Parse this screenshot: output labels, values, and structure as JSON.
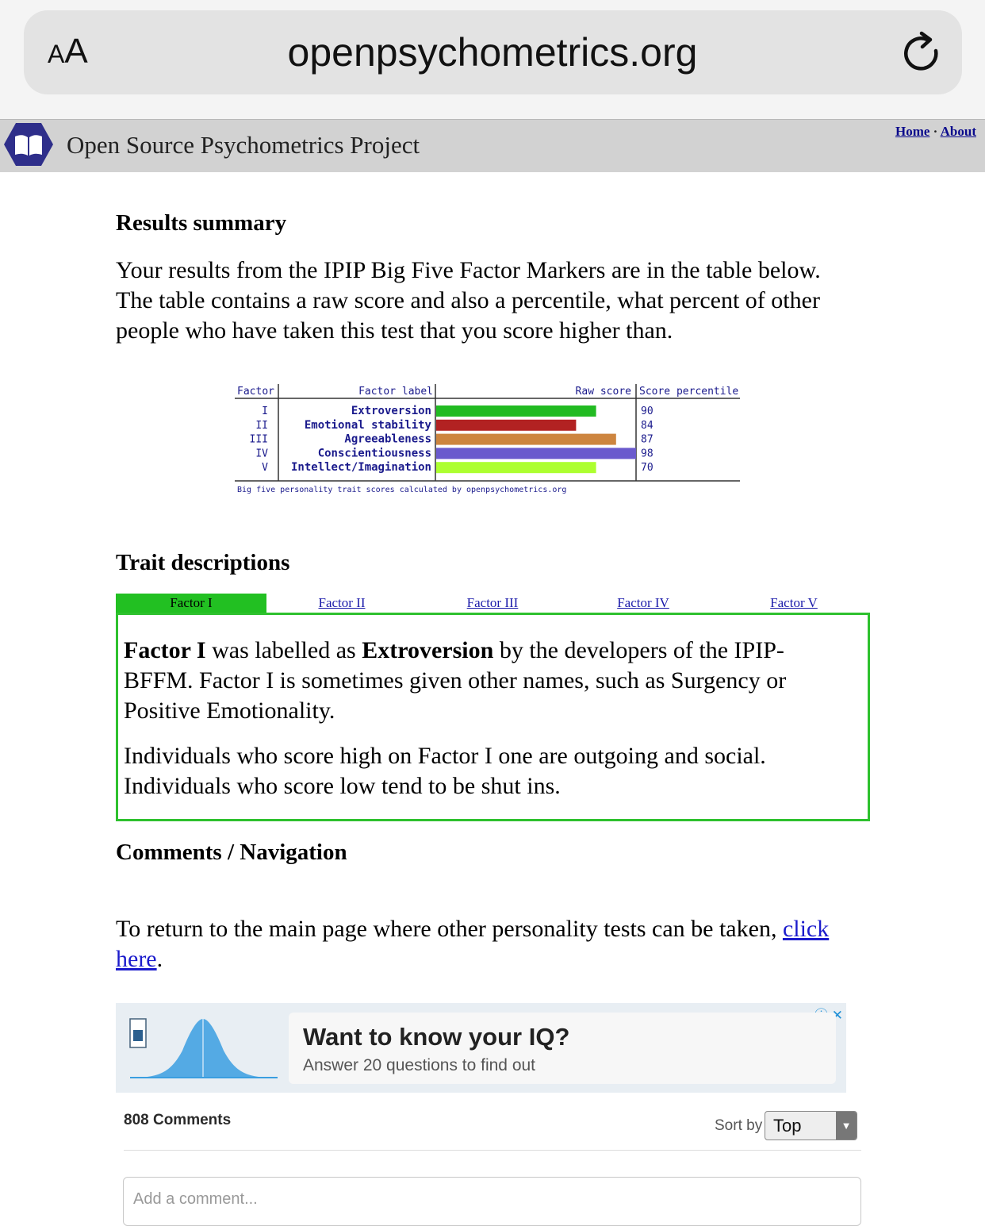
{
  "browser": {
    "aa_small": "A",
    "aa_big": "A",
    "url": "openpsychometrics.org"
  },
  "site": {
    "title": "Open Source Psychometrics Project",
    "links": [
      "Home",
      "About"
    ],
    "separator": "·"
  },
  "results": {
    "heading": "Results summary",
    "intro": "Your results from the IPIP Big Five Factor Markers are in the table below. The table contains a raw score and also a percentile, what percent of other people who have taken this test that you score higher than."
  },
  "chart_data": {
    "type": "table",
    "columns": [
      "Factor",
      "Factor label",
      "Raw score",
      "Score percentile"
    ],
    "rows": [
      {
        "factor": "I",
        "label": "Extroversion",
        "raw_score_fraction": 0.8,
        "percentile": "90",
        "color": "#22bb22"
      },
      {
        "factor": "II",
        "label": "Emotional stability",
        "raw_score_fraction": 0.7,
        "percentile": "84",
        "color": "#b22222"
      },
      {
        "factor": "III",
        "label": "Agreeableness",
        "raw_score_fraction": 0.9,
        "percentile": "87",
        "color": "#cd853f"
      },
      {
        "factor": "IV",
        "label": "Conscientiousness",
        "raw_score_fraction": 1.0,
        "percentile": "98",
        "color": "#6a5acd"
      },
      {
        "factor": "V",
        "label": "Intellect/Imagination",
        "raw_score_fraction": 0.8,
        "percentile": "70",
        "color": "#adff2f"
      }
    ],
    "caption": "Big five personality trait scores calculated by openpsychometrics.org"
  },
  "traits": {
    "heading": "Trait descriptions",
    "tabs": [
      "Factor I",
      "Factor II",
      "Factor III",
      "Factor IV",
      "Factor V"
    ],
    "active_tab": "Factor I",
    "p1": {
      "factor": "Factor I",
      "mid1": " was labelled as ",
      "label": "Extroversion",
      "rest": " by the developers of the IPIP-BFFM. Factor I is sometimes given other names, such as Surgency or Positive Emotionality."
    },
    "p2": "Individuals who score high on Factor I one are outgoing and social. Individuals who score low tend to be shut ins."
  },
  "nav": {
    "heading": "Comments / Navigation",
    "text": "To return to the main page where other personality tests can be taken, ",
    "link": "click here",
    "end": "."
  },
  "ad": {
    "headline": "Want to know your IQ?",
    "sub": "Answer 20 questions to find out"
  },
  "comments": {
    "count": "808 Comments",
    "sort_label": "Sort by",
    "sort_value": "Top",
    "placeholder": "Add a comment..."
  },
  "colors": {
    "accent_green": "#2ec12e",
    "link": "#1b1bcc",
    "header_bg": "#d2d2d2"
  }
}
